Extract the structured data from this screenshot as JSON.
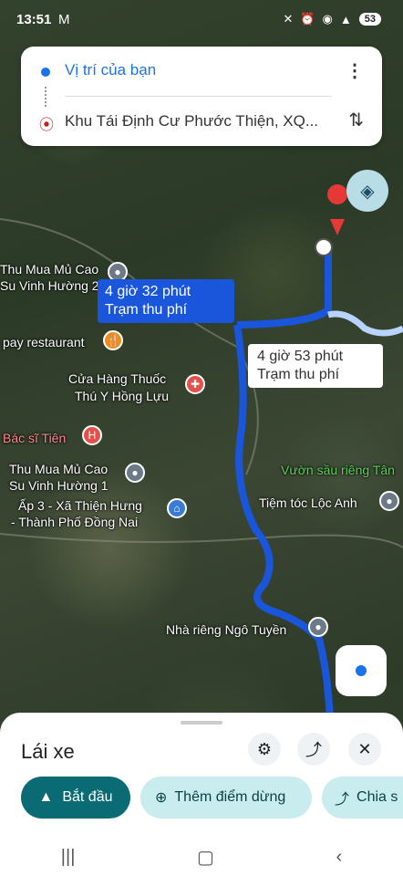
{
  "status_bar": {
    "time": "13:51",
    "mail_icon": "M",
    "battery": "53"
  },
  "search": {
    "origin": "Vị trí của bạn",
    "destination": "Khu Tái Định Cư Phước Thiện, XQ..."
  },
  "map": {
    "labels": [
      {
        "id": "thu-mua-1a",
        "text": "Thu Mua Mủ Cao"
      },
      {
        "id": "thu-mua-1b",
        "text": "Su Vinh Hường 2"
      },
      {
        "id": "pay-restaurant",
        "text": "pay restaurant"
      },
      {
        "id": "cua-hang-a",
        "text": "Cửa Hàng Thuốc"
      },
      {
        "id": "cua-hang-b",
        "text": "Thú Y Hồng Lựu"
      },
      {
        "id": "bac-si",
        "text": "Bác sĩ Tiên"
      },
      {
        "id": "thu-mua-2a",
        "text": "Thu Mua Mủ Cao"
      },
      {
        "id": "thu-mua-2b",
        "text": "Su Vinh Hường 1"
      },
      {
        "id": "ap3-a",
        "text": "Ấp 3 - Xã Thiện Hưng"
      },
      {
        "id": "ap3-b",
        "text": "- Thành Phố Đồng Nai"
      },
      {
        "id": "vuon",
        "text": "Vườn sầu riêng Tân"
      },
      {
        "id": "tiem-toc",
        "text": "Tiệm tóc Lộc Anh"
      },
      {
        "id": "nha-rieng",
        "text": "Nhà riêng Ngô Tuyền"
      }
    ],
    "route_primary": {
      "duration": "4 giờ 32 phút",
      "note": "Trạm thu phí"
    },
    "route_alt": {
      "duration": "4 giờ 53 phút",
      "note": "Trạm thu phí"
    },
    "route_color": "#1a56db"
  },
  "sheet": {
    "mode": "Lái xe",
    "start_label": "Bắt đầu",
    "add_stop_label": "Thêm điểm dừng",
    "share_label": "Chia s"
  }
}
